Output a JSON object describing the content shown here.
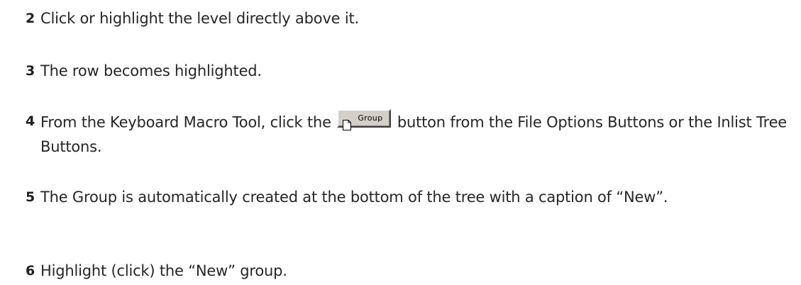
{
  "steps": [
    {
      "number": "2",
      "text": "Click or highlight the level directly above it."
    },
    {
      "number": "3",
      "text": "The row becomes highlighted."
    },
    {
      "number": "4",
      "text_before": "From the Keyboard Macro Tool, click the",
      "button": {
        "icon": "new-document-icon",
        "label": "Group"
      },
      "text_after": "button from the File Options Buttons or the Inlist Tree Buttons."
    },
    {
      "number": "5",
      "text": "The Group is automatically created at the bottom of the tree with a caption of “New”."
    },
    {
      "number": "6",
      "text": "Highlight (click) the “New” group."
    }
  ]
}
